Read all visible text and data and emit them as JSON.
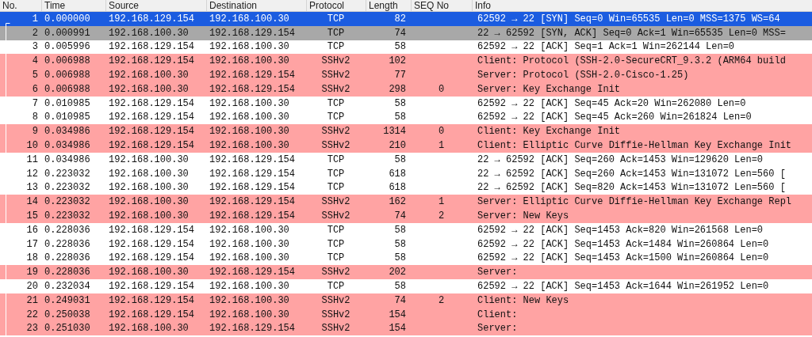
{
  "columns": [
    "No.",
    "Time",
    "Source",
    "Destination",
    "Protocol",
    "Length",
    "SEQ No",
    "Info"
  ],
  "rows": [
    {
      "no": "1",
      "time": "0.000000",
      "source": "192.168.129.154",
      "destination": "192.168.100.30",
      "protocol": "TCP",
      "length": "82",
      "info": "62592 → 22 [SYN] Seq=0 Win=65535 Len=0 MSS=1375 WS=64",
      "selected": true
    },
    {
      "no": "2",
      "time": "0.000991",
      "source": "192.168.100.30",
      "destination": "192.168.129.154",
      "protocol": "TCP",
      "length": "74",
      "info": "22 → 62592 [SYN, ACK] Seq=0 Ack=1 Win=65535 Len=0 MSS=",
      "kind": "handshake",
      "selected": false
    },
    {
      "no": "3",
      "time": "0.005996",
      "source": "192.168.129.154",
      "destination": "192.168.100.30",
      "protocol": "TCP",
      "length": "58",
      "info": "62592 → 22 [ACK] Seq=1 Ack=1 Win=262144 Len=0",
      "kind": "plain",
      "selected": false
    },
    {
      "no": "4",
      "time": "0.006988",
      "source": "192.168.129.154",
      "destination": "192.168.100.30",
      "protocol": "SSHv2",
      "length": "102",
      "info": "Client: Protocol (SSH-2.0-SecureCRT_9.3.2 (ARM64 build",
      "kind": "ssh",
      "selected": false
    },
    {
      "no": "5",
      "time": "0.006988",
      "source": "192.168.100.30",
      "destination": "192.168.129.154",
      "protocol": "SSHv2",
      "length": "77",
      "info": "Server: Protocol (SSH-2.0-Cisco-1.25)",
      "kind": "ssh",
      "selected": false
    },
    {
      "no": "6",
      "time": "0.006988",
      "source": "192.168.100.30",
      "destination": "192.168.129.154",
      "protocol": "SSHv2",
      "length": "298",
      "seq_no": "0",
      "info": "Server: Key Exchange Init",
      "kind": "ssh",
      "selected": false
    },
    {
      "no": "7",
      "time": "0.010985",
      "source": "192.168.129.154",
      "destination": "192.168.100.30",
      "protocol": "TCP",
      "length": "58",
      "info": "62592 → 22 [ACK] Seq=45 Ack=20 Win=262080 Len=0",
      "kind": "plain",
      "selected": false
    },
    {
      "no": "8",
      "time": "0.010985",
      "source": "192.168.129.154",
      "destination": "192.168.100.30",
      "protocol": "TCP",
      "length": "58",
      "info": "62592 → 22 [ACK] Seq=45 Ack=260 Win=261824 Len=0",
      "kind": "plain",
      "selected": false
    },
    {
      "no": "9",
      "time": "0.034986",
      "source": "192.168.129.154",
      "destination": "192.168.100.30",
      "protocol": "SSHv2",
      "length": "1314",
      "seq_no": "0",
      "info": "Client: Key Exchange Init",
      "kind": "ssh",
      "selected": false
    },
    {
      "no": "10",
      "time": "0.034986",
      "source": "192.168.129.154",
      "destination": "192.168.100.30",
      "protocol": "SSHv2",
      "length": "210",
      "seq_no": "1",
      "info": "Client: Elliptic Curve Diffie-Hellman Key Exchange Init",
      "kind": "ssh",
      "selected": false
    },
    {
      "no": "11",
      "time": "0.034986",
      "source": "192.168.100.30",
      "destination": "192.168.129.154",
      "protocol": "TCP",
      "length": "58",
      "info": "22 → 62592 [ACK] Seq=260 Ack=1453 Win=129620 Len=0",
      "kind": "plain",
      "selected": false
    },
    {
      "no": "12",
      "time": "0.223032",
      "source": "192.168.100.30",
      "destination": "192.168.129.154",
      "protocol": "TCP",
      "length": "618",
      "info": "22 → 62592 [ACK] Seq=260 Ack=1453 Win=131072 Len=560 [",
      "kind": "plain",
      "selected": false
    },
    {
      "no": "13",
      "time": "0.223032",
      "source": "192.168.100.30",
      "destination": "192.168.129.154",
      "protocol": "TCP",
      "length": "618",
      "info": "22 → 62592 [ACK] Seq=820 Ack=1453 Win=131072 Len=560 [",
      "kind": "plain",
      "selected": false
    },
    {
      "no": "14",
      "time": "0.223032",
      "source": "192.168.100.30",
      "destination": "192.168.129.154",
      "protocol": "SSHv2",
      "length": "162",
      "seq_no": "1",
      "info": "Server: Elliptic Curve Diffie-Hellman Key Exchange Repl",
      "kind": "ssh",
      "selected": false
    },
    {
      "no": "15",
      "time": "0.223032",
      "source": "192.168.100.30",
      "destination": "192.168.129.154",
      "protocol": "SSHv2",
      "length": "74",
      "seq_no": "2",
      "info": "Server: New Keys",
      "kind": "ssh",
      "selected": false
    },
    {
      "no": "16",
      "time": "0.228036",
      "source": "192.168.129.154",
      "destination": "192.168.100.30",
      "protocol": "TCP",
      "length": "58",
      "info": "62592 → 22 [ACK] Seq=1453 Ack=820 Win=261568 Len=0",
      "kind": "plain",
      "selected": false
    },
    {
      "no": "17",
      "time": "0.228036",
      "source": "192.168.129.154",
      "destination": "192.168.100.30",
      "protocol": "TCP",
      "length": "58",
      "info": "62592 → 22 [ACK] Seq=1453 Ack=1484 Win=260864 Len=0",
      "kind": "plain",
      "selected": false
    },
    {
      "no": "18",
      "time": "0.228036",
      "source": "192.168.129.154",
      "destination": "192.168.100.30",
      "protocol": "TCP",
      "length": "58",
      "info": "62592 → 22 [ACK] Seq=1453 Ack=1500 Win=260864 Len=0",
      "kind": "plain",
      "selected": false
    },
    {
      "no": "19",
      "time": "0.228036",
      "source": "192.168.100.30",
      "destination": "192.168.129.154",
      "protocol": "SSHv2",
      "length": "202",
      "info": "Server:",
      "kind": "ssh",
      "selected": false
    },
    {
      "no": "20",
      "time": "0.232034",
      "source": "192.168.129.154",
      "destination": "192.168.100.30",
      "protocol": "TCP",
      "length": "58",
      "info": "62592 → 22 [ACK] Seq=1453 Ack=1644 Win=261952 Len=0",
      "kind": "plain",
      "selected": false
    },
    {
      "no": "21",
      "time": "0.249031",
      "source": "192.168.129.154",
      "destination": "192.168.100.30",
      "protocol": "SSHv2",
      "length": "74",
      "seq_no": "2",
      "info": "Client: New Keys",
      "kind": "ssh",
      "selected": false
    },
    {
      "no": "22",
      "time": "0.250038",
      "source": "192.168.129.154",
      "destination": "192.168.100.30",
      "protocol": "SSHv2",
      "length": "154",
      "info": "Client:",
      "kind": "ssh",
      "selected": false
    },
    {
      "no": "23",
      "time": "0.251030",
      "source": "192.168.100.30",
      "destination": "192.168.129.154",
      "protocol": "SSHv2",
      "length": "154",
      "info": "Server:",
      "kind": "ssh",
      "selected": false
    }
  ]
}
